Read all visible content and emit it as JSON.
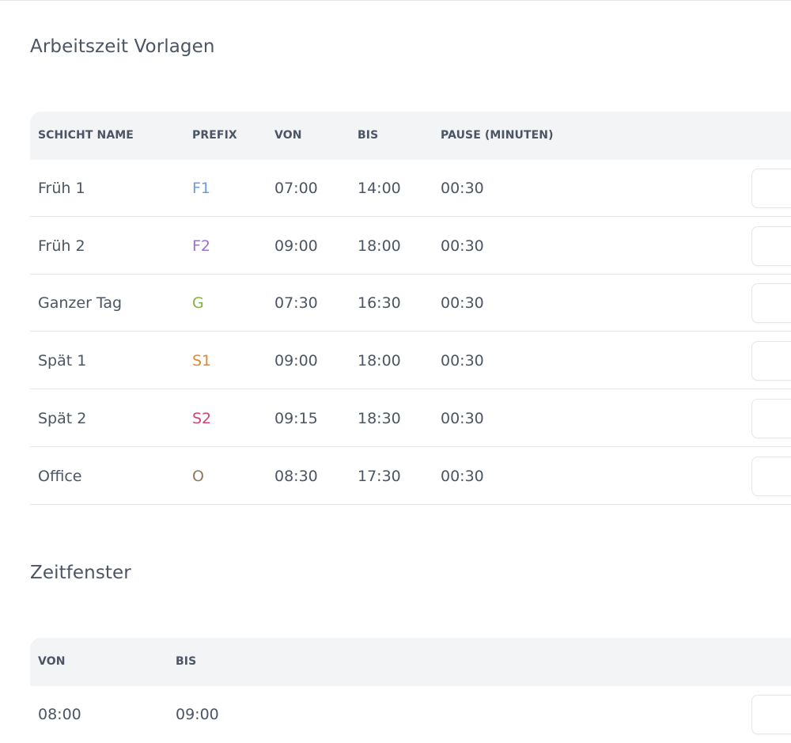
{
  "shift_templates": {
    "title": "Arbeitszeit Vorlagen",
    "columns": {
      "name": "SCHICHT NAME",
      "prefix": "PREFIX",
      "from": "VON",
      "to": "BIS",
      "pause": "PAUSE (MINUTEN)"
    },
    "rows": [
      {
        "name": "Früh 1",
        "prefix": "F1",
        "prefix_color": "#6b9be0",
        "from": "07:00",
        "to": "14:00",
        "pause": "00:30"
      },
      {
        "name": "Früh 2",
        "prefix": "F2",
        "prefix_color": "#9b72d4",
        "from": "09:00",
        "to": "18:00",
        "pause": "00:30"
      },
      {
        "name": "Ganzer Tag",
        "prefix": "G",
        "prefix_color": "#7cb342",
        "from": "07:30",
        "to": "16:30",
        "pause": "00:30"
      },
      {
        "name": "Spät 1",
        "prefix": "S1",
        "prefix_color": "#e08a2c",
        "from": "09:00",
        "to": "18:00",
        "pause": "00:30"
      },
      {
        "name": "Spät 2",
        "prefix": "S2",
        "prefix_color": "#d1437a",
        "from": "09:15",
        "to": "18:30",
        "pause": "00:30"
      },
      {
        "name": "Office",
        "prefix": "O",
        "prefix_color": "#8a7a60",
        "from": "08:30",
        "to": "17:30",
        "pause": "00:30"
      }
    ]
  },
  "time_windows": {
    "title": "Zeitfenster",
    "columns": {
      "from": "VON",
      "to": "BIS"
    },
    "rows": [
      {
        "from": "08:00",
        "to": "09:00"
      }
    ]
  }
}
